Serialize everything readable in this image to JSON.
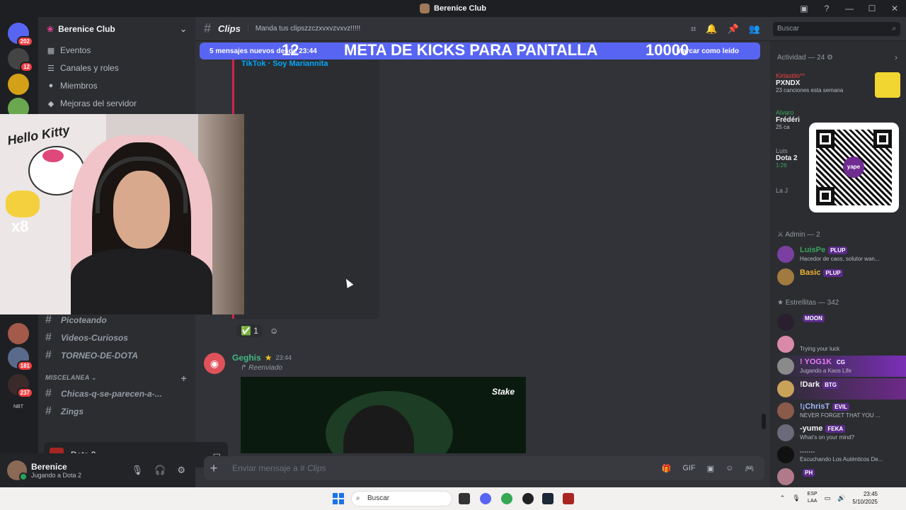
{
  "window": {
    "title": "Berenice Club"
  },
  "guilds": {
    "badges": [
      "202",
      "12",
      "181",
      "237"
    ],
    "bottom_label": "NBT"
  },
  "sidebar": {
    "server_name": "Berenice Club",
    "nav": [
      {
        "label": "Eventos",
        "icon": "calendar-icon"
      },
      {
        "label": "Canales y roles",
        "icon": "list-icon"
      },
      {
        "label": "Miembros",
        "icon": "members-icon"
      },
      {
        "label": "Mejoras del servidor",
        "icon": "boost-icon"
      }
    ],
    "channels": [
      {
        "label": "Picoteando"
      },
      {
        "label": "Videos-Curiosos"
      },
      {
        "label": "TORNEO-DE-DOTA"
      }
    ],
    "category": "MISCELANEA",
    "misc_channels": [
      {
        "label": "Chicas-q-se-parecen-a-..."
      },
      {
        "label": "Zings"
      }
    ]
  },
  "voice": {
    "label": "Dota 2"
  },
  "user": {
    "name": "Berenice",
    "status": "Jugando a Dota 2"
  },
  "channel": {
    "name": "Clips",
    "topic": "Manda tus clipszzczxvxvzvxvz!!!!!"
  },
  "search": {
    "placeholder": "Buscar"
  },
  "new_messages": {
    "text": "5 mensajes nuevos desde 23:44",
    "mark_read": "Marcar como leído"
  },
  "stream_overlay": {
    "count": "12",
    "text": "META DE KICKS PARA PANTALLA",
    "goal": "10000"
  },
  "embed": {
    "author": "TikTok · Soy Mariannita"
  },
  "reactions": {
    "check_count": "1"
  },
  "message": {
    "author": "Geghis",
    "time": "23:44",
    "forwarded": "Reenviado",
    "video_brand": "Stake"
  },
  "composer": {
    "placeholder": "Enviar mensaje a #",
    "channel": "Clips"
  },
  "activity": {
    "header": "Actividad — 24",
    "cards": [
      {
        "who": "Kirlastilo**",
        "what": "PXNDX",
        "sub": "23 canciones esta semana"
      },
      {
        "who": "Alvaro",
        "what": "Frédéri",
        "sub": "25 ca"
      },
      {
        "who": "Luis",
        "what": "Dota 2",
        "sub": "1:26"
      },
      {
        "who": "La J",
        "what": "",
        "sub": ""
      }
    ]
  },
  "members": {
    "admin_header": "Admin — 2",
    "admins": [
      {
        "name": "LuisPe",
        "tag": "PLUP",
        "status": "Hacedor de caos, solutor wan...",
        "color": "#3ba55c"
      },
      {
        "name": "Basic",
        "tag": "PLUP",
        "status": "",
        "color": "#f0b232"
      }
    ],
    "stars_header": "Estrellitas — 342",
    "stars": [
      {
        "name": "",
        "tag": "MOON",
        "status": "",
        "color": "#f23f43"
      },
      {
        "name": "",
        "tag": "",
        "status": "Trying your luck",
        "color": "#f23f43"
      },
      {
        "name": "! YOG1K",
        "tag": "CG",
        "status": "Jugando a Kaos Life",
        "color": "#e879f9"
      },
      {
        "name": "!Dark",
        "tag": "BTG",
        "status": "",
        "color": "#f5f5f5"
      },
      {
        "name": "!¡ChrisT",
        "tag": "EVIL",
        "status": "NEVER FORGET THAT YOU ...",
        "color": "#a5b4fc"
      },
      {
        "name": "-yume",
        "tag": "FEKA",
        "status": "What's on your mind?",
        "color": "#f2f3f5"
      },
      {
        "name": ".......",
        "tag": "",
        "status": "Escuchando Los Auténticos De...",
        "color": "#949ba4"
      },
      {
        "name": "",
        "tag": "PH",
        "status": "",
        "color": "#f2f3f5"
      }
    ]
  },
  "webcam": {
    "sticker_text": "Hello Kitty",
    "multiplier": "x8"
  },
  "taskbar": {
    "search": "Buscar",
    "lang1": "ESP",
    "lang2": "LAA",
    "time": "23:45",
    "date": "5/10/2025"
  }
}
